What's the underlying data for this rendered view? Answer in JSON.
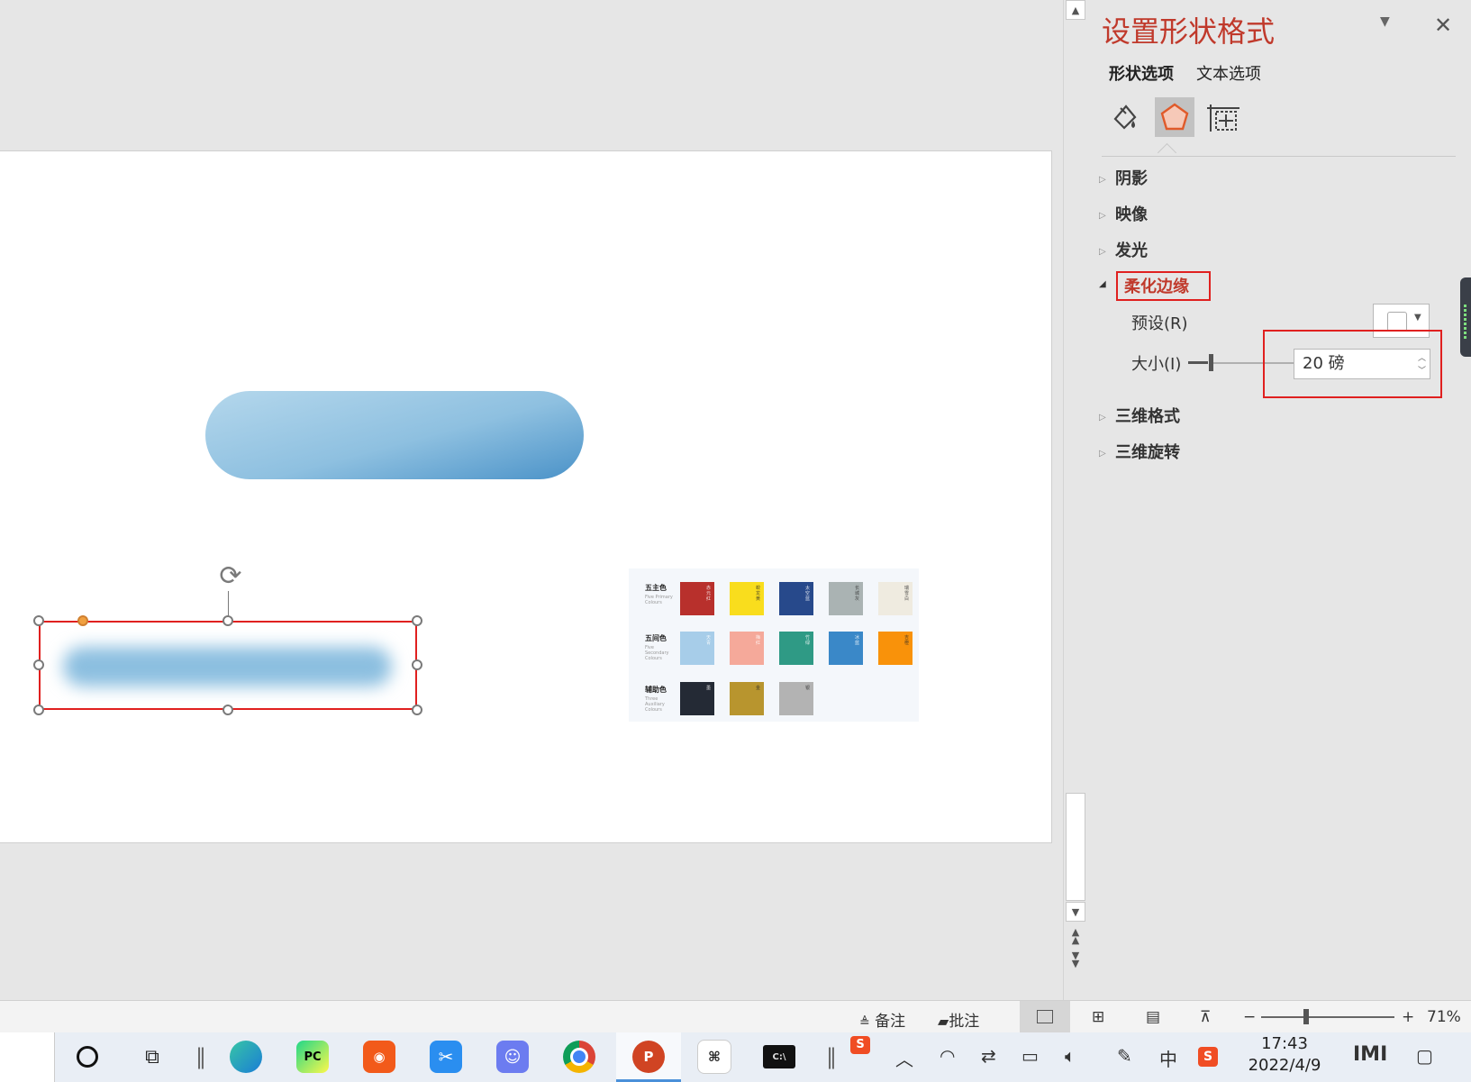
{
  "pane": {
    "title": "设置形状格式",
    "tabs": [
      "形状选项",
      "文本选项"
    ],
    "sections": {
      "shadow": "阴影",
      "reflection": "映像",
      "glow": "发光",
      "soft_edges": "柔化边缘",
      "format_3d": "三维格式",
      "rotation_3d": "三维旋转"
    },
    "soft_edges": {
      "preset_label": "预设(R)",
      "size_label": "大小(I)",
      "size_value": "20 磅"
    },
    "icons": [
      "fill-line-icon",
      "effects-pentagon-icon",
      "size-properties-icon"
    ]
  },
  "palette": {
    "rows": [
      {
        "label": "五主色",
        "sub": "Five Primary Colours",
        "swatches": [
          {
            "color": "#b8302c",
            "name": "赤元红"
          },
          {
            "color": "#f9dd1d",
            "name": "蛟龙黄"
          },
          {
            "color": "#27498b",
            "name": "太空蓝"
          },
          {
            "color": "#aab3b3",
            "name": "长城灰"
          },
          {
            "color": "#efebe0",
            "name": "瑞雪白"
          }
        ]
      },
      {
        "label": "五间色",
        "sub": "Five Secondary Colours",
        "swatches": [
          {
            "color": "#a7cde9",
            "name": "天青"
          },
          {
            "color": "#f5a99a",
            "name": "梅红"
          },
          {
            "color": "#2f9a85",
            "name": "竹绿"
          },
          {
            "color": "#3a88c8",
            "name": "冰蓝"
          },
          {
            "color": "#f9920a",
            "name": "吉橙"
          }
        ]
      },
      {
        "label": "辅助色",
        "sub": "Three Auxiliary Colours",
        "swatches": [
          {
            "color": "#242a35",
            "name": "墨"
          },
          {
            "color": "#b8952e",
            "name": "金"
          },
          {
            "color": "#b3b3b3",
            "name": "银"
          }
        ]
      }
    ]
  },
  "status": {
    "notes": "备注",
    "comments": "批注",
    "zoom": "71%"
  },
  "taskbar": {
    "time": "17:43",
    "date": "2022/4/9",
    "apps": [
      "edge-icon",
      "pycharm-icon",
      "app-orange-icon",
      "scissors-icon",
      "code-monkey-icon",
      "chrome-icon",
      "powerpoint-icon",
      "app-white-icon",
      "terminal-icon"
    ]
  },
  "colors": {
    "accent_red": "#c0392b",
    "highlight": "#e0201f"
  }
}
